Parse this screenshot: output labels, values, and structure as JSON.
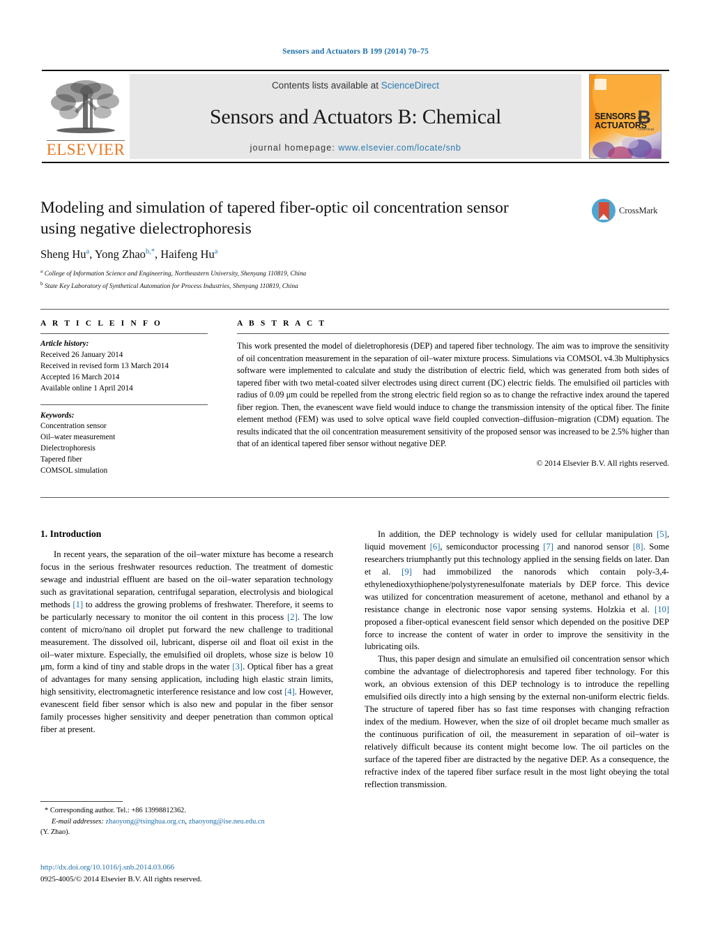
{
  "running_head": "Sensors and Actuators B 199 (2014) 70–75",
  "masthead": {
    "contents_prefix": "Contents lists available at ",
    "sciencedirect": "ScienceDirect",
    "journal_name": "Sensors and Actuators B: Chemical",
    "homepage_prefix": "journal homepage: ",
    "homepage_url": "www.elsevier.com/locate/snb",
    "publisher": "ELSEVIER",
    "cover": {
      "line1": "SENSORS",
      "and": "and",
      "line2": "ACTUATORS",
      "letter": "B",
      "sub": "Chemical"
    },
    "link_color": "#2a7ab0"
  },
  "article": {
    "title": "Modeling and simulation of tapered fiber-optic oil concentration sensor using negative dielectrophoresis",
    "crossmark_label": "CrossMark",
    "authors_html": "Sheng Hu<sup>a</sup>, Yong Zhao<sup>b,*</sup>, Haifeng Hu<sup>a</sup>",
    "affiliation_a": "College of Information Science and Engineering, Northeastern University, Shenyang 110819, China",
    "affiliation_b": "State Key Laboratory of Synthetical Automation for Process Industries, Shenyang 110819, China"
  },
  "article_info": {
    "heading": "A R T I C L E   I N F O",
    "history_label": "Article history:",
    "history": [
      "Received 26 January 2014",
      "Received in revised form 13 March 2014",
      "Accepted 16 March 2014",
      "Available online 1 April 2014"
    ],
    "keywords_label": "Keywords:",
    "keywords": [
      "Concentration sensor",
      "Oil–water measurement",
      "Dielectrophoresis",
      "Tapered fiber",
      "COMSOL simulation"
    ]
  },
  "abstract": {
    "heading": "A B S T R A C T",
    "text": "This work presented the model of dieletrophoresis (DEP) and tapered fiber technology. The aim was to improve the sensitivity of oil concentration measurement in the separation of oil–water mixture process. Simulations via COMSOL v4.3b Multiphysics software were implemented to calculate and study the distribution of electric field, which was generated from both sides of tapered fiber with two metal-coated silver electrodes using direct current (DC) electric fields. The emulsified oil particles with radius of 0.09 μm could be repelled from the strong electric field region so as to change the refractive index around the tapered fiber region. Then, the evanescent wave field would induce to change the transmission intensity of the optical fiber. The finite element method (FEM) was used to solve optical wave field coupled convection–diffusion–migration (CDM) equation. The results indicated that the oil concentration measurement sensitivity of the proposed sensor was increased to be 2.5% higher than that of an identical tapered fiber sensor without negative DEP.",
    "copyright": "© 2014 Elsevier B.V. All rights reserved."
  },
  "sections": {
    "introduction_heading": "1.  Introduction",
    "left_paragraphs": [
      "In recent years, the separation of the oil–water mixture has become a research focus in the serious freshwater resources reduction. The treatment of domestic sewage and industrial effluent are based on the oil–water separation technology such as gravitational separation, centrifugal separation, electrolysis and biological methods <span class=\"ref\">[1]</span> to address the growing problems of freshwater. Therefore, it seems to be particularly necessary to monitor the oil content in this process <span class=\"ref\">[2]</span>. The low content of micro/nano oil droplet put forward the new challenge to traditional measurement. The dissolved oil, lubricant, disperse oil and float oil exist in the oil–water mixture. Especially, the emulsified oil droplets, whose size is below 10 μm, form a kind of tiny and stable drops in the water <span class=\"ref\">[3]</span>. Optical fiber has a great of advantages for many sensing application, including high elastic strain limits, high sensitivity, electromagnetic interference resistance and low cost <span class=\"ref\">[4]</span>. However, evanescent field fiber sensor which is also new and popular in the fiber sensor family processes higher sensitivity and deeper penetration than common optical fiber at present."
    ],
    "right_paragraphs": [
      "In addition, the DEP technology is widely used for cellular manipulation <span class=\"ref\">[5]</span>, liquid movement <span class=\"ref\">[6]</span>, semiconductor processing <span class=\"ref\">[7]</span> and nanorod sensor <span class=\"ref\">[8]</span>. Some researchers triumphantly put this technology applied in the sensing fields on later. Dan et al. <span class=\"ref\">[9]</span> had immobilized the nanorods which contain poly-3,4-ethylenedioxythiophene/polystyrenesulfonate materials by DEP force. This device was utilized for concentration measurement of acetone, methanol and ethanol by a resistance change in electronic nose vapor sensing systems. Holzkia et al. <span class=\"ref\">[10]</span> proposed a fiber-optical evanescent field sensor which depended on the positive DEP force to increase the content of water in order to improve the sensitivity in the lubricating oils.",
      "Thus, this paper design and simulate an emulsified oil concentration sensor which combine the advantage of dielectrophoresis and tapered fiber technology. For this work, an obvious extension of this DEP technology is to introduce the repelling emulsified oils directly into a high sensing by the external non-uniform electric fields. The structure of tapered fiber has so fast time responses with changing refraction index of the medium. However, when the size of oil droplet became much smaller as the continuous purification of oil, the measurement in separation of oil–water is relatively difficult because its content might become low. The oil particles on the surface of the tapered fiber are distracted by the negative DEP. As a consequence, the refractive index of the tapered fiber surface result in the most light obeying the total reflection transmission."
    ]
  },
  "footer": {
    "corresponding_marker": "*",
    "corresponding_text": "Corresponding author. Tel.: +86 13998812362.",
    "email_label": "E-mail addresses:",
    "email1": "zhaoyong@tsinghua.org.cn",
    "email_sep": ", ",
    "email2": "zhaoyong@ise.neu.edu.cn",
    "email_suffix": "(Y. Zhao).",
    "doi": "http://dx.doi.org/10.1016/j.snb.2014.03.066",
    "issn_line": "0925-4005/© 2014 Elsevier B.V. All rights reserved."
  }
}
